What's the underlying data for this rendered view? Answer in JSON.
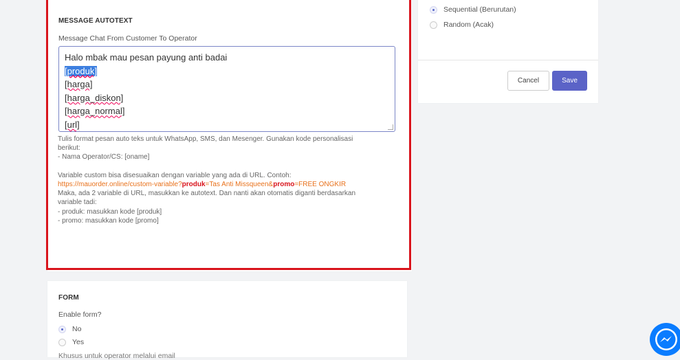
{
  "autotext": {
    "title": "MESSAGE AUTOTEXT",
    "field_label": "Message Chat From Customer To Operator",
    "textarea_lines": [
      "Halo mbak mau pesan payung anti badai",
      "[produk]",
      "[harga]",
      "[harga_diskon]",
      "[harga_normal]",
      "[url]"
    ],
    "help": {
      "line1": "Tulis format pesan auto teks untuk WhatsApp, SMS, dan Mesenger. Gunakan kode personalisasi",
      "line2": "berikut:",
      "line3": "- Nama Operator/CS: [oname]",
      "line4": "Variable custom bisa disesuaikan dengan variable yang ada di URL. Contoh:",
      "url_part1": "https://mauorder.online/custom-variable?",
      "url_part2": "produk",
      "url_part3": "=Tas Anti Missqueen&",
      "url_part4": "promo",
      "url_part5": "=FREE ONGKIR",
      "line6": "Maka, ada 2 variable di URL, masukkan ke autotext. Dan nanti akan otomatis diganti berdasarkan",
      "line7": "variable tadi:",
      "line8": "- produk: masukkan kode [produk]",
      "line9": "- promo: masukkan kode [promo]"
    }
  },
  "distribution": {
    "option_sequential": "Sequential (Berurutan)",
    "option_random": "Random (Acak)",
    "selected": "Sequential (Berurutan)",
    "cancel_label": "Cancel",
    "save_label": "Save"
  },
  "form": {
    "title": "FORM",
    "enable_label": "Enable form?",
    "option_no": "No",
    "option_yes": "Yes",
    "selected": "No",
    "note": "Khusus untuk operator melalui email"
  },
  "colors": {
    "highlight_border": "#d9141c",
    "primary": "#5b63c7",
    "messenger": "#0a7cff"
  }
}
